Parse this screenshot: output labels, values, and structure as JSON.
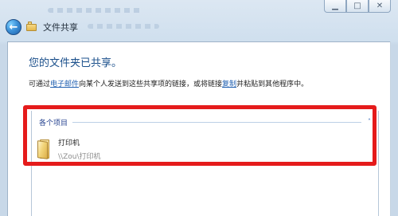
{
  "window": {
    "title": "文件共享",
    "controls": {
      "minimize": "▁",
      "maximize": "□",
      "close": "✕"
    }
  },
  "content": {
    "heading": "您的文件夹已共享。",
    "desc_prefix": "可通过",
    "desc_link1": "电子邮件",
    "desc_middle": "向某个人发送到这些共享项的链接，或将链接",
    "desc_link2": "复制",
    "desc_suffix": "并粘贴到其他程序中。"
  },
  "items": {
    "group_label": "各个项目",
    "chevron": "˄",
    "entries": [
      {
        "name": "打印机",
        "path": "\\\\Zou\\打印机"
      }
    ]
  },
  "icons": {
    "back": "arrow-left",
    "folder": "folder",
    "close": "close",
    "minimize": "minimize",
    "maximize": "maximize",
    "chevron": "chevron-up"
  },
  "colors": {
    "accent": "#1a4f8b",
    "link": "#2261b1",
    "highlight": "#e51b1b"
  }
}
